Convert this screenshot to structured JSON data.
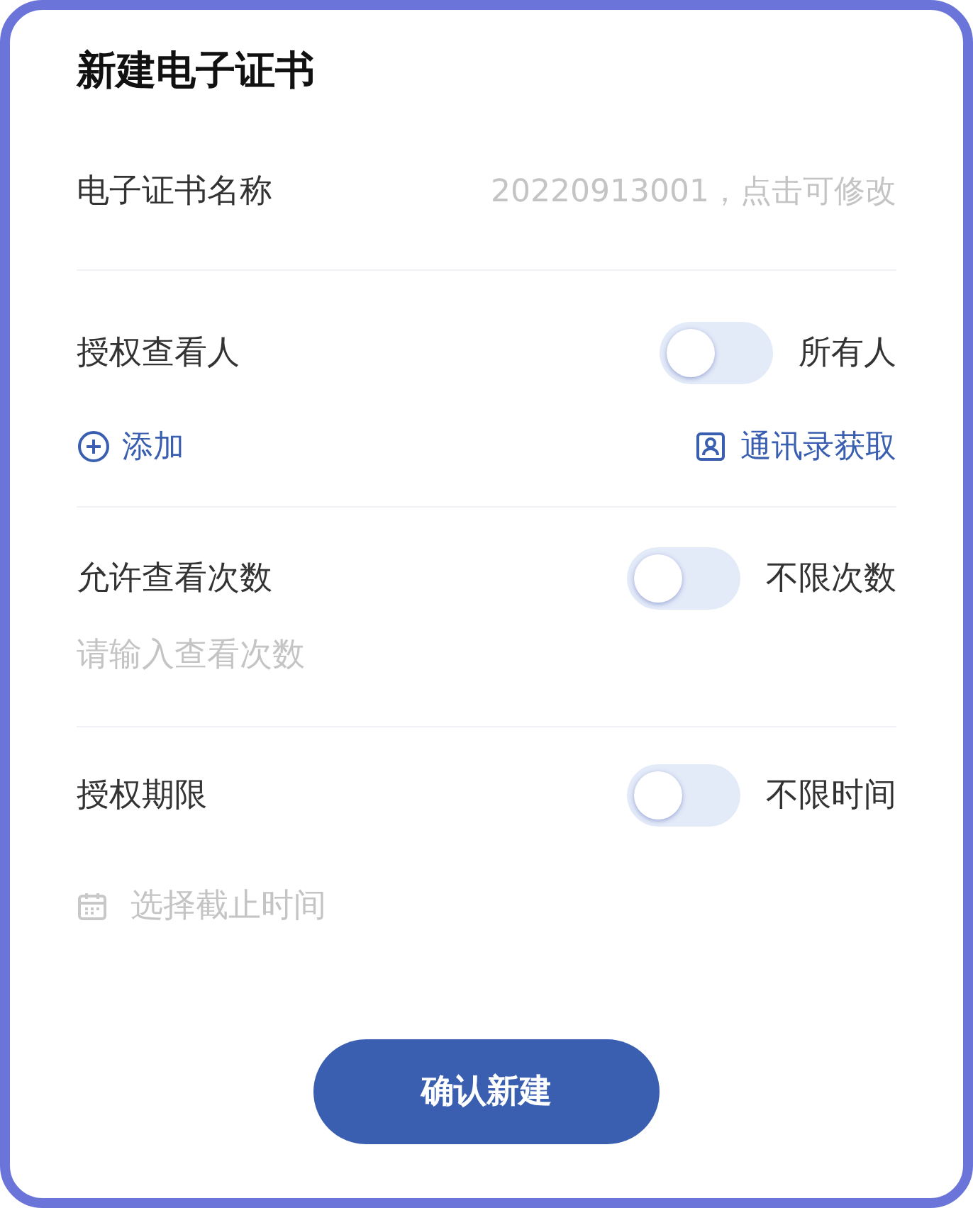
{
  "title": "新建电子证书",
  "name_field": {
    "label": "电子证书名称",
    "placeholder": "20220913001，点击可修改"
  },
  "sections": [
    {
      "kind": "viewers",
      "label": "授权查看人",
      "toggle": {
        "on": false
      },
      "toggle_label": "所有人",
      "add_link": "添加",
      "contacts_link": "通讯录获取"
    },
    {
      "kind": "count",
      "label": "允许查看次数",
      "toggle": {
        "on": false
      },
      "toggle_label": "不限次数",
      "placeholder": "请输入查看次数"
    },
    {
      "kind": "period",
      "label": "授权期限",
      "toggle": {
        "on": false
      },
      "toggle_label": "不限时间",
      "placeholder": "选择截止时间"
    }
  ],
  "confirm_button": "确认新建"
}
